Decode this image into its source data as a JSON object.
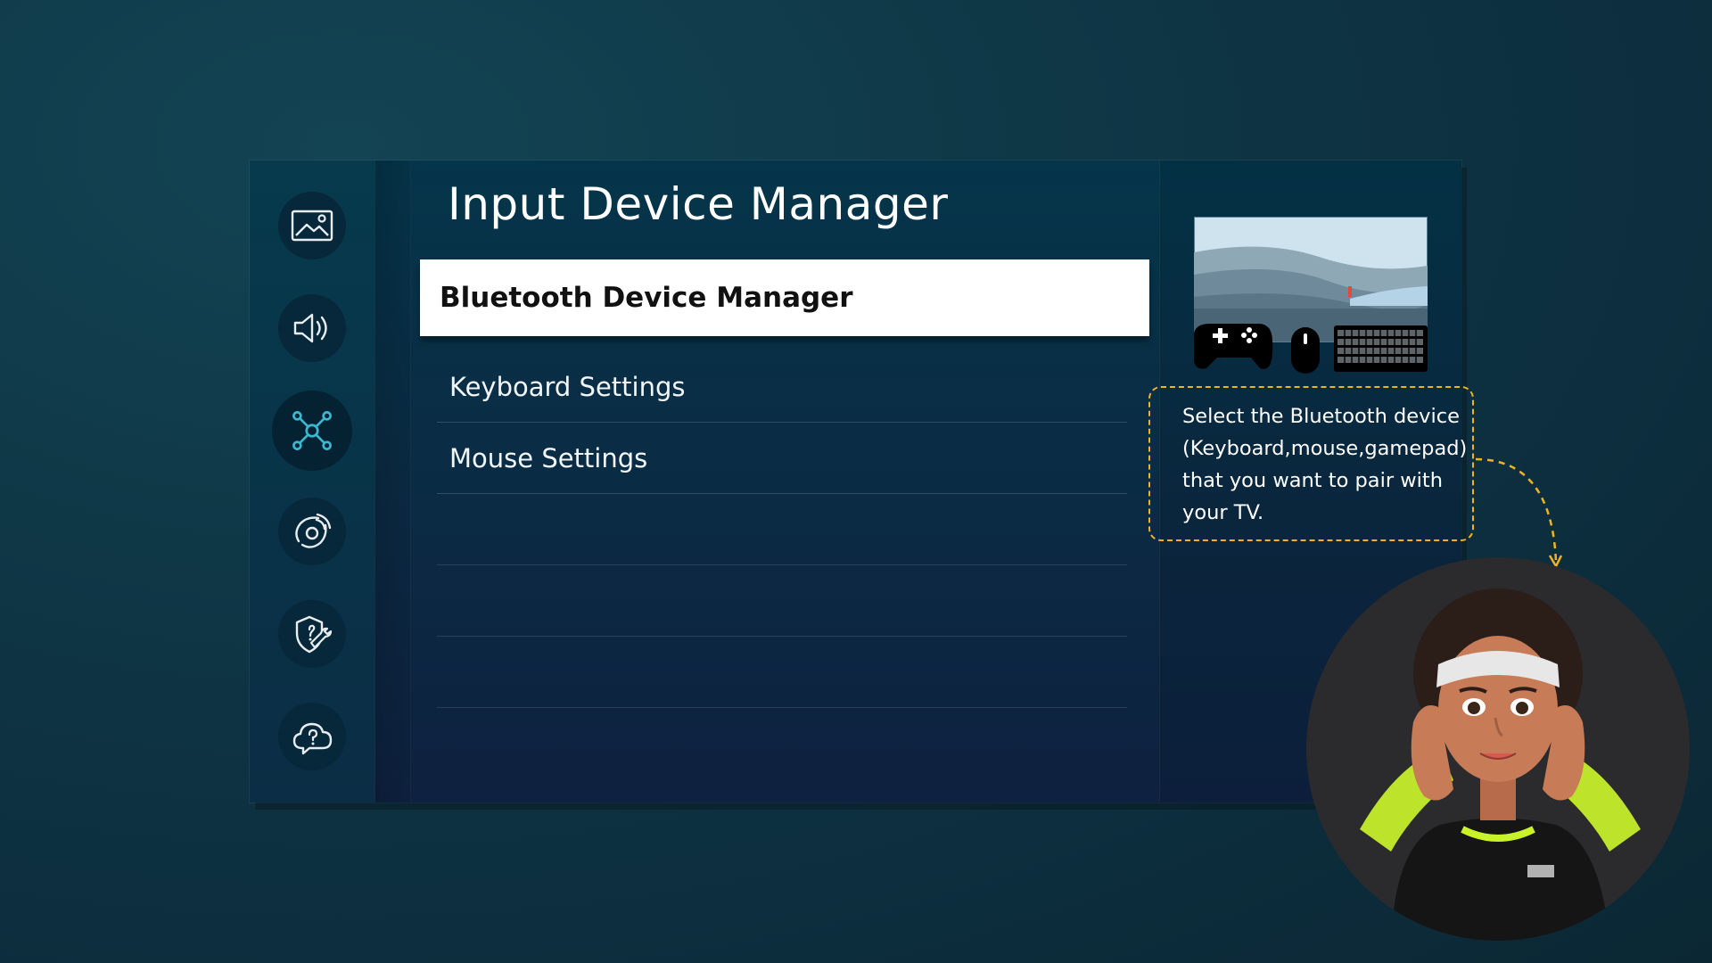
{
  "page": {
    "title": "Input Device Manager"
  },
  "menu": {
    "items": [
      {
        "label": "Bluetooth Device Manager",
        "selected": true
      },
      {
        "label": "Keyboard Settings",
        "selected": false
      },
      {
        "label": "Mouse Settings",
        "selected": false
      }
    ]
  },
  "sidebar": {
    "icons": [
      {
        "name": "picture-icon"
      },
      {
        "name": "sound-icon"
      },
      {
        "name": "connection-icon",
        "active": true
      },
      {
        "name": "broadcast-icon"
      },
      {
        "name": "support-icon"
      },
      {
        "name": "help-icon"
      }
    ]
  },
  "info": {
    "description": "Select the Bluetooth device (Keyboard,mouse,gamepad) that you want to pair with your TV."
  },
  "colors": {
    "accent": "#f0b323",
    "active_icon": "#3bb8d0",
    "selected_bg": "#ffffff"
  }
}
